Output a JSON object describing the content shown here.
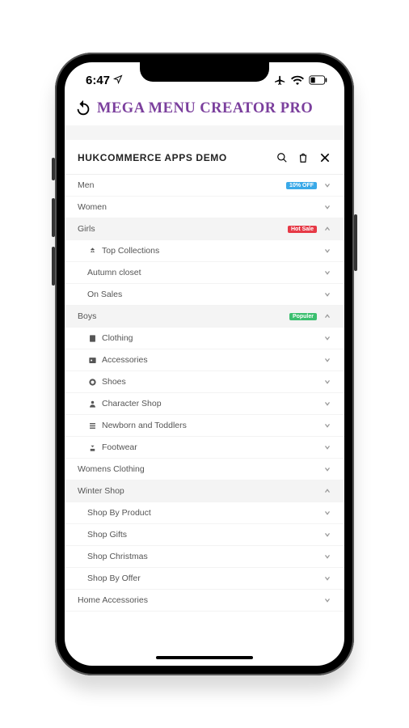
{
  "status": {
    "time": "6:47"
  },
  "app": {
    "title": "MEGA MENU CREATOR PRO"
  },
  "demo": {
    "title": "HUKCOMMERCE APPS DEMO"
  },
  "menu": {
    "men": {
      "label": "Men",
      "badge": "10% OFF"
    },
    "women": {
      "label": "Women"
    },
    "girls": {
      "label": "Girls",
      "badge": "Hot Sale",
      "items": {
        "top": "Top Collections",
        "autumn": "Autumn closet",
        "sale": "On Sales"
      }
    },
    "boys": {
      "label": "Boys",
      "badge": "Populer",
      "items": {
        "clothing": "Clothing",
        "accessories": "Accessories",
        "shoes": "Shoes",
        "character": "Character Shop",
        "newborn": "Newborn and Toddlers",
        "footwear": "Footwear"
      }
    },
    "womens_clothing": {
      "label": "Womens Clothing"
    },
    "winter": {
      "label": "Winter Shop",
      "items": {
        "product": "Shop By Product",
        "gifts": "Shop Gifts",
        "christmas": "Shop Christmas",
        "offer": "Shop By Offer"
      }
    },
    "home_acc": {
      "label": "Home Accessories"
    }
  }
}
